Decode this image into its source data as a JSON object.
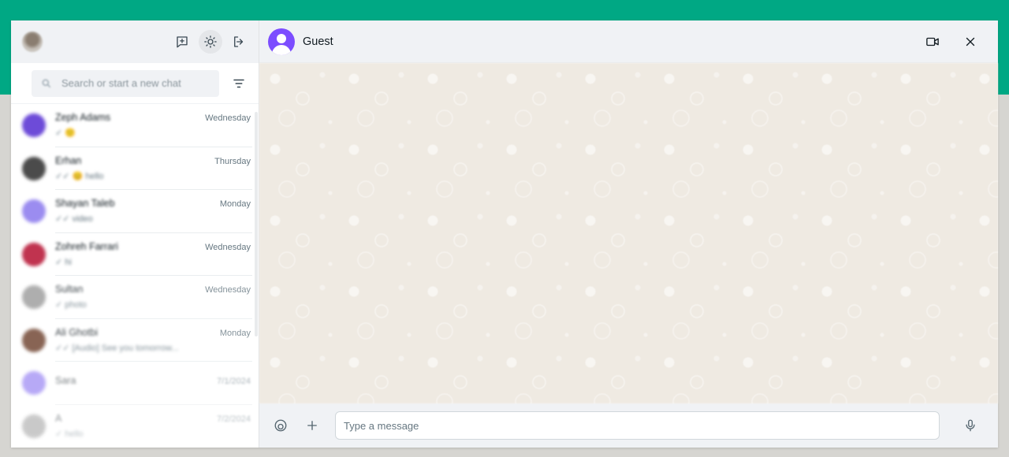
{
  "colors": {
    "brand": "#00a884",
    "accent": "#7c4dff",
    "panel": "#f0f2f5",
    "wallpaper": "#efeae2"
  },
  "sidebar": {
    "header": {
      "icons": [
        "new-chat-icon",
        "theme-toggle-icon",
        "logout-icon"
      ]
    },
    "search": {
      "placeholder": "Search or start a new chat"
    },
    "chats": [
      {
        "name": "Zeph Adams",
        "time": "Wednesday",
        "preview": "✓ 🙂",
        "avatar_color": "#6d4bd8"
      },
      {
        "name": "Erhan",
        "time": "Thursday",
        "preview": "✓✓ 😊 hello",
        "avatar_color": "#4b4b4b"
      },
      {
        "name": "Shayan Taleb",
        "time": "Monday",
        "preview": "✓✓ video",
        "avatar_color": "#9b8cf0"
      },
      {
        "name": "Zohreh Farrari",
        "time": "Wednesday",
        "preview": "✓ hi",
        "avatar_color": "#c0334f"
      },
      {
        "name": "Sultan",
        "time": "Wednesday",
        "preview": "✓ photo",
        "avatar_color": "#9a9a9a"
      },
      {
        "name": "Ali Ghotbi",
        "time": "Monday",
        "preview": "✓✓ [Audio] See you tomorrow...",
        "avatar_color": "#6b3e2a"
      },
      {
        "name": "Sara",
        "time": "7/1/2024",
        "preview": "",
        "avatar_color": "#7d63f0"
      },
      {
        "name": "A",
        "time": "7/2/2024",
        "preview": "✓ hello",
        "avatar_color": "#8a8a8a"
      }
    ]
  },
  "chat": {
    "contact_name": "Guest",
    "header_icons": [
      "video-call-icon",
      "close-icon"
    ],
    "composer": {
      "placeholder": "Type a message",
      "icons": [
        "emoji-icon",
        "attach-plus-icon",
        "microphone-icon"
      ]
    }
  }
}
